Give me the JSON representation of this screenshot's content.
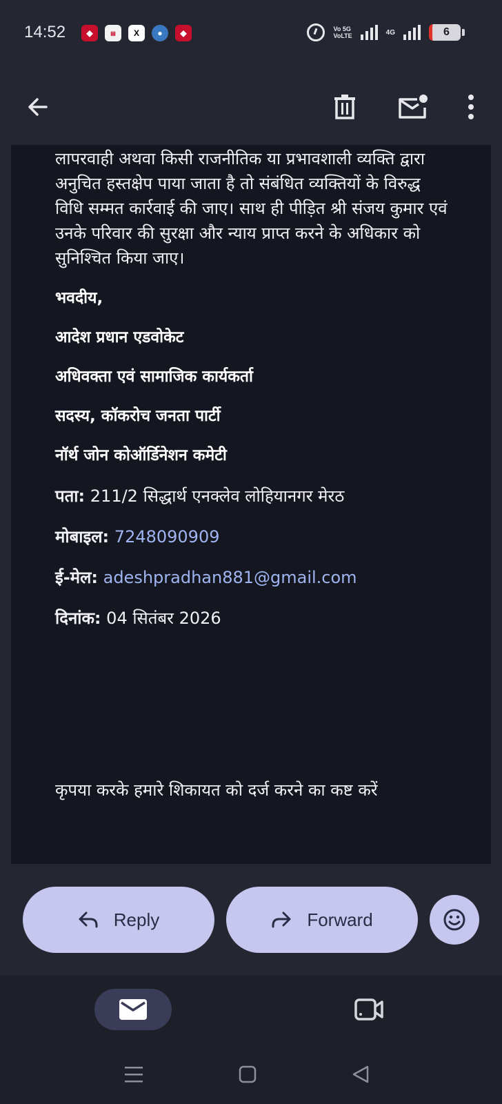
{
  "status_bar": {
    "time": "14:52",
    "notification_icons": [
      "app-icon",
      "news-icon",
      "x-icon",
      "globe-icon",
      "app-icon"
    ],
    "volte_label_1": "Vo 5G",
    "volte_label_2": "VoLTE",
    "network_label": "4G",
    "battery_level": "6"
  },
  "app_bar": {
    "icons": [
      "back-arrow-icon",
      "trash-icon",
      "mark-unread-icon",
      "more-vert-icon"
    ]
  },
  "email": {
    "body_lines": [
      "लापरवाही अथवा किसी राजनीतिक या प्रभावशाली व्यक्ति द्वारा",
      "अनुचित हस्तक्षेप पाया जाता है तो संबंधित व्यक्तियों के विरुद्ध",
      "विधि सम्मत कार्रवाई की जाए। साथ ही पीड़ित श्री संजय कुमार एवं",
      "उनके परिवार की सुरक्षा और न्याय प्राप्त करने के अधिकार को",
      "सुनिश्चित किया जाए।"
    ],
    "closing": "भवदीय,",
    "signature_name": "आदेश प्रधान एडवोकेट",
    "signature_role": "अधिवक्ता एवं सामाजिक कार्यकर्ता",
    "signature_member": "सदस्य, कॉकरोच जनता पार्टी",
    "signature_committee": "नॉर्थ जोन कोऑर्डिनेशन कमेटी",
    "address_label": "पता:",
    "address_value": "211/2 सिद्धार्थ एनक्लेव लोहियानगर मेरठ",
    "mobile_label": "मोबाइल:",
    "mobile_value": "7248090909",
    "email_label": "ई-मेल:",
    "email_value": "adeshpradhan881@gmail.com",
    "date_label": "दिनांक:",
    "date_value": "04 सितंबर 2026",
    "footer_text": "कृपया करके हमारे शिकायत को दर्ज करने का कष्ट करें"
  },
  "actions": {
    "reply_label": "Reply",
    "forward_label": "Forward",
    "emoji_icon": "emoji-react-icon"
  },
  "bottom_nav": {
    "items": [
      "mail-icon",
      "video-call-icon"
    ],
    "active": "mail"
  },
  "system_nav": [
    "menu-icon",
    "home-icon",
    "back-icon"
  ],
  "colors": {
    "background": "#242631",
    "content_background": "#151720",
    "button_pill": "#c6c6ee",
    "link": "#9fb4f0",
    "active_nav": "#3b3d58"
  }
}
